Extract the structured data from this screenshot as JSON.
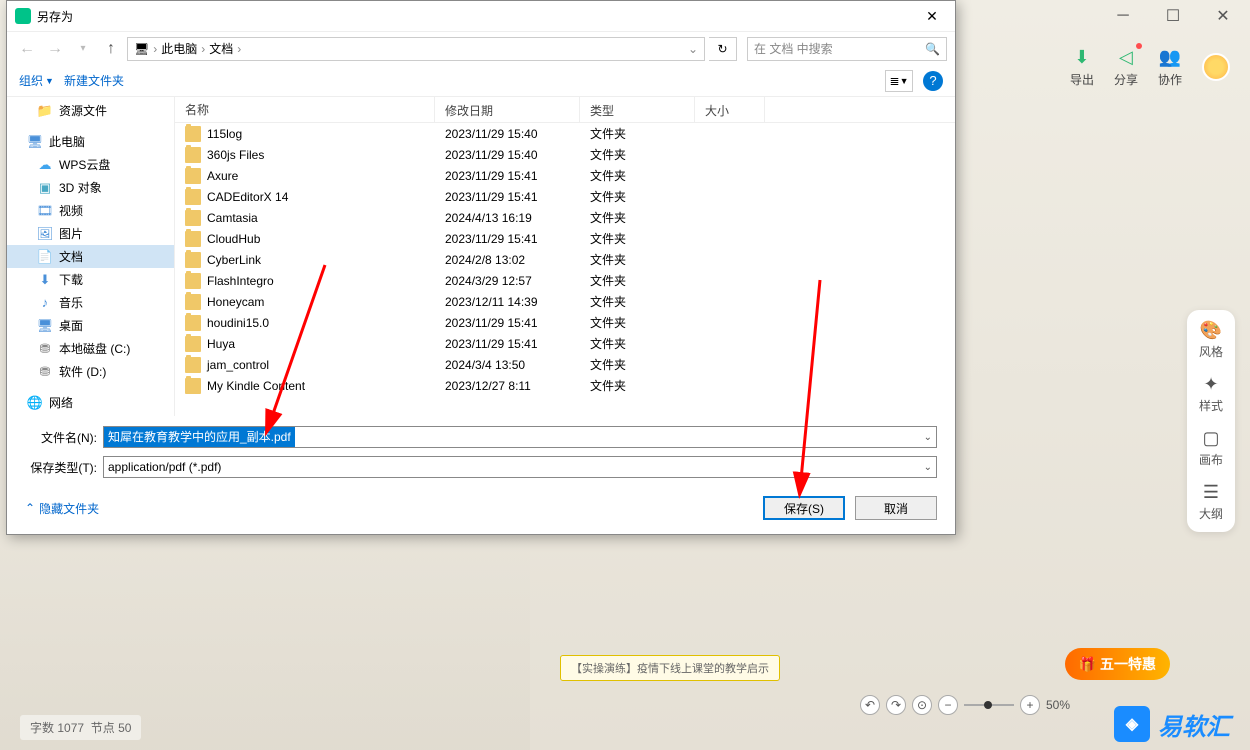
{
  "bg": {
    "tools": {
      "export": "导出",
      "share": "分享",
      "collab": "协作"
    },
    "right_panel": {
      "style": "风格",
      "format": "样式",
      "canvas": "画布",
      "outline": "大纲"
    },
    "footer": {
      "words_label": "字数",
      "words": "1077",
      "nodes_label": "节点",
      "nodes": "50"
    },
    "zoom": "50%",
    "logo": "易软汇",
    "promo": "五一特惠",
    "mm_node": "【实操演练】疫情下线上课堂的教学启示"
  },
  "dialog": {
    "title": "另存为",
    "breadcrumb": {
      "pc": "此电脑",
      "docs": "文档"
    },
    "search_placeholder": "在 文档 中搜索",
    "toolbar": {
      "organize": "组织",
      "new_folder": "新建文件夹"
    },
    "tree": {
      "resources": "资源文件",
      "pc": "此电脑",
      "wps": "WPS云盘",
      "3d": "3D 对象",
      "video": "视频",
      "pictures": "图片",
      "documents": "文档",
      "downloads": "下载",
      "music": "音乐",
      "desktop": "桌面",
      "c_drive": "本地磁盘 (C:)",
      "d_drive": "软件 (D:)",
      "network": "网络"
    },
    "columns": {
      "name": "名称",
      "date": "修改日期",
      "type": "类型",
      "size": "大小"
    },
    "type_folder": "文件夹",
    "files": [
      {
        "name": "115log",
        "date": "2023/11/29 15:40"
      },
      {
        "name": "360js Files",
        "date": "2023/11/29 15:40"
      },
      {
        "name": "Axure",
        "date": "2023/11/29 15:41"
      },
      {
        "name": "CADEditorX 14",
        "date": "2023/11/29 15:41"
      },
      {
        "name": "Camtasia",
        "date": "2024/4/13 16:19"
      },
      {
        "name": "CloudHub",
        "date": "2023/11/29 15:41"
      },
      {
        "name": "CyberLink",
        "date": "2024/2/8 13:02"
      },
      {
        "name": "FlashIntegro",
        "date": "2024/3/29 12:57"
      },
      {
        "name": "Honeycam",
        "date": "2023/12/11 14:39"
      },
      {
        "name": "houdini15.0",
        "date": "2023/11/29 15:41"
      },
      {
        "name": "Huya",
        "date": "2023/11/29 15:41"
      },
      {
        "name": "jam_control",
        "date": "2024/3/4 13:50"
      },
      {
        "name": "My Kindle Content",
        "date": "2023/12/27 8:11"
      }
    ],
    "filename_label": "文件名(N):",
    "filename_value": "知犀在教育教学中的应用_副本.pdf",
    "filetype_label": "保存类型(T):",
    "filetype_value": "application/pdf (*.pdf)",
    "hide_folders": "隐藏文件夹",
    "save_btn": "保存(S)",
    "cancel_btn": "取消"
  }
}
